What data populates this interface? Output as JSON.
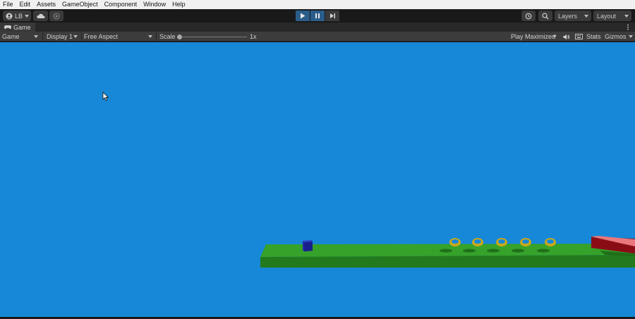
{
  "menu": [
    "File",
    "Edit",
    "Assets",
    "GameObject",
    "Component",
    "Window",
    "Help"
  ],
  "toolbar": {
    "account_label": "LB",
    "layers_label": "Layers",
    "layout_label": "Layout"
  },
  "game_tab": {
    "label": "Game"
  },
  "game_controls": {
    "view_mode": "Game",
    "display": "Display 1",
    "aspect": "Free Aspect",
    "scale_label": "Scale",
    "scale_value": "1x",
    "scale_level": 0.0,
    "play_mode": "Play Maximized",
    "stats_label": "Stats",
    "gizmos_label": "Gizmos"
  },
  "scene": {
    "sky_color": "#1788d7",
    "ground_color": "#36a22a",
    "player_color": "#1d2ba8",
    "coin_color": "#c8a81c",
    "goal_color": "#8a0d16",
    "coin_count": 5
  }
}
